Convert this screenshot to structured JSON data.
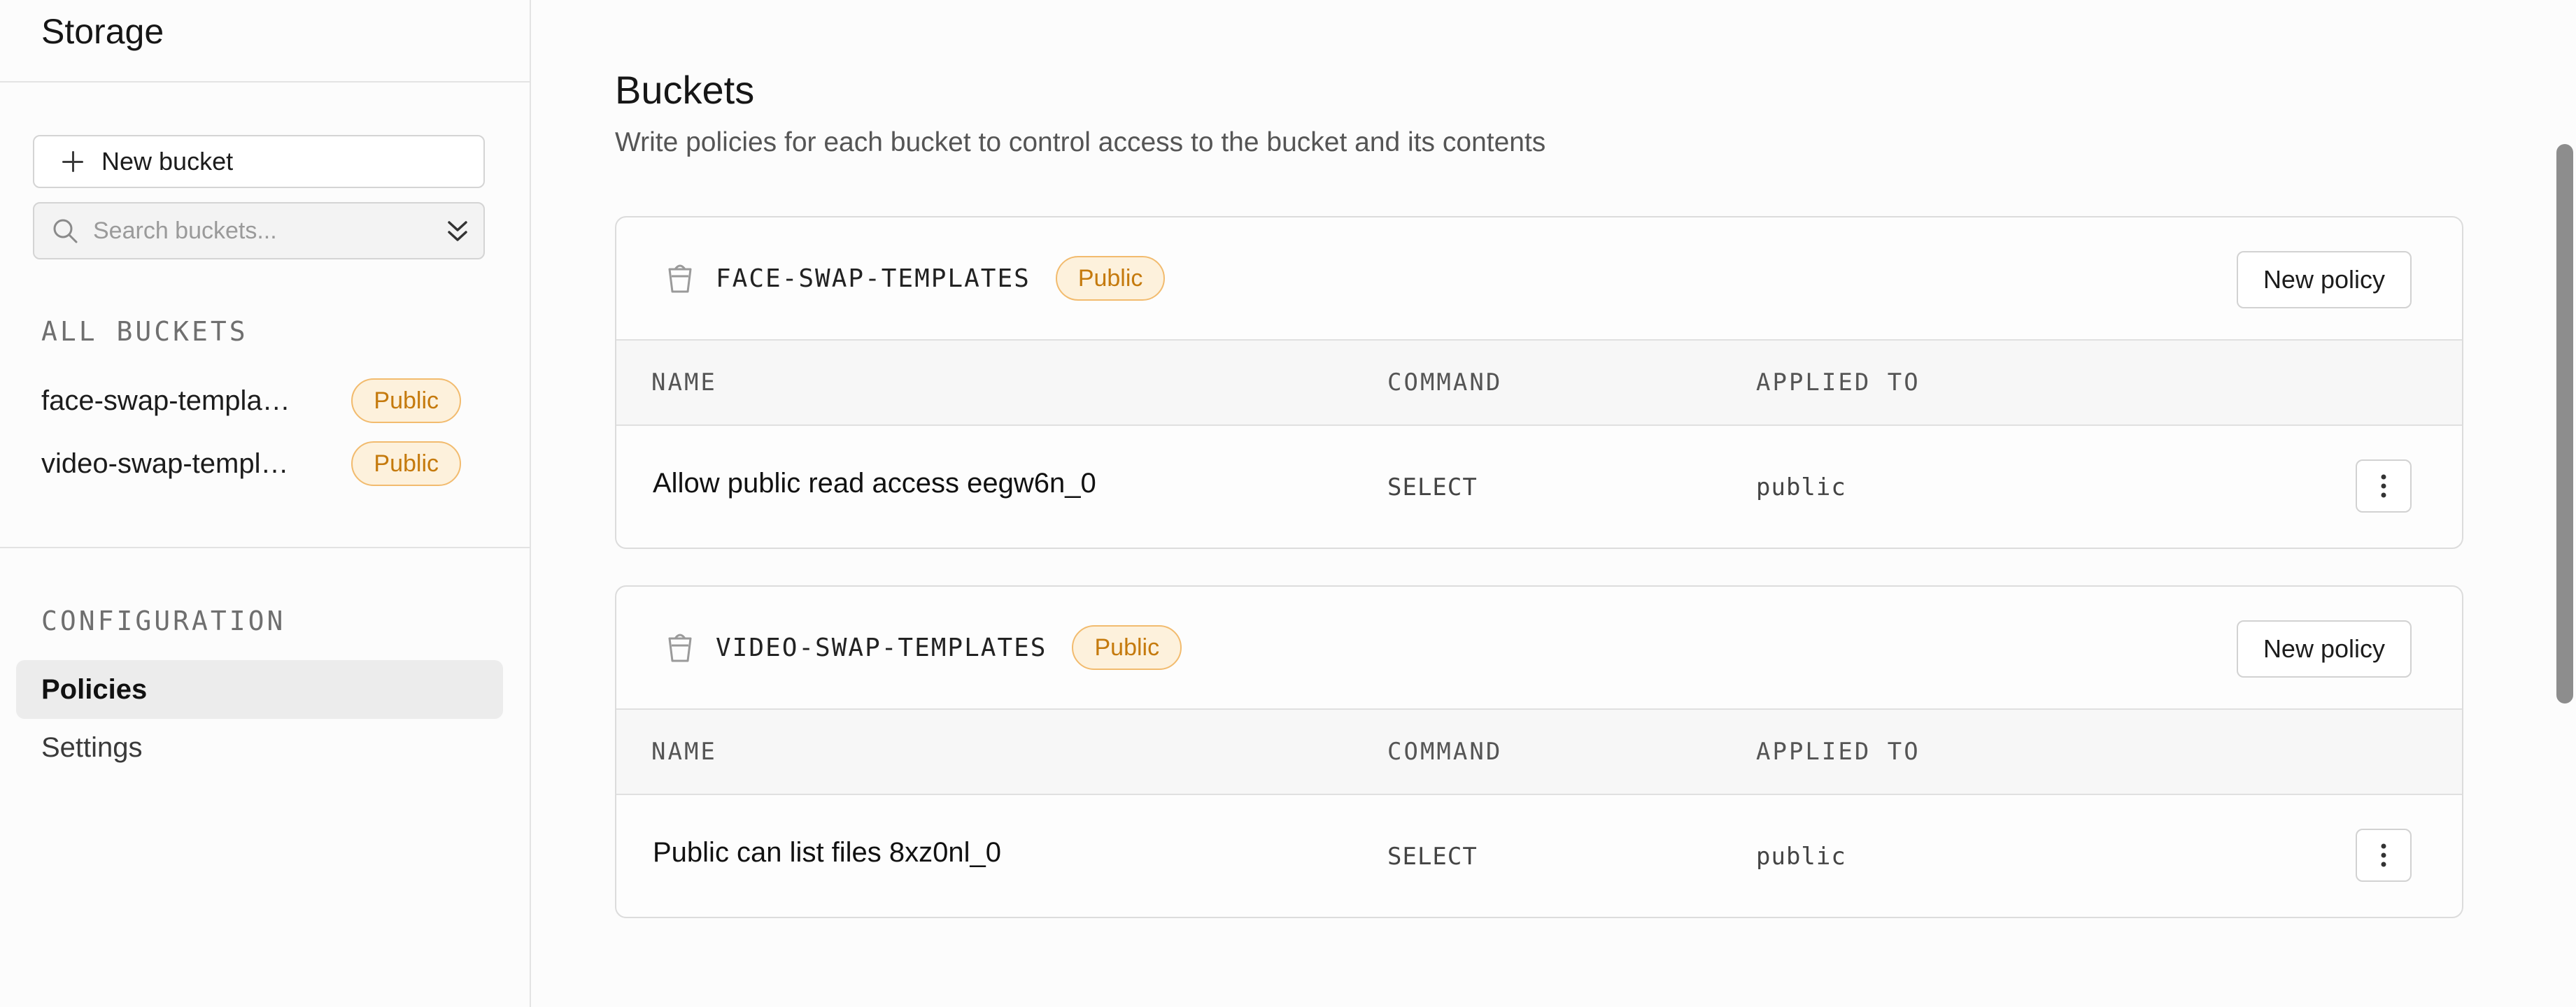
{
  "sidebar": {
    "title": "Storage",
    "new_bucket_label": "New bucket",
    "search_placeholder": "Search buckets...",
    "all_buckets_label": "ALL BUCKETS",
    "buckets": [
      {
        "name": "face-swap-templates",
        "badge": "Public"
      },
      {
        "name": "video-swap-templates",
        "badge": "Public"
      }
    ],
    "configuration_label": "CONFIGURATION",
    "nav": [
      {
        "label": "Policies",
        "active": true
      },
      {
        "label": "Settings",
        "active": false
      }
    ]
  },
  "main": {
    "title": "Buckets",
    "subtitle": "Write policies for each bucket to control access to the bucket and its contents",
    "new_policy_label": "New policy",
    "columns": [
      "NAME",
      "COMMAND",
      "APPLIED TO"
    ],
    "cards": [
      {
        "bucket": "FACE-SWAP-TEMPLATES",
        "badge": "Public",
        "policies": [
          {
            "name": "Allow public read access eegw6n_0",
            "command": "SELECT",
            "applied_to": "public"
          }
        ]
      },
      {
        "bucket": "VIDEO-SWAP-TEMPLATES",
        "badge": "Public",
        "policies": [
          {
            "name": "Public can list files 8xz0nl_0",
            "command": "SELECT",
            "applied_to": "public"
          }
        ]
      }
    ]
  },
  "colors": {
    "badge_bg": "#fdf1dc",
    "badge_border": "#f2bb6e",
    "badge_text": "#c57a0d",
    "active_nav_bg": "#ececec"
  }
}
